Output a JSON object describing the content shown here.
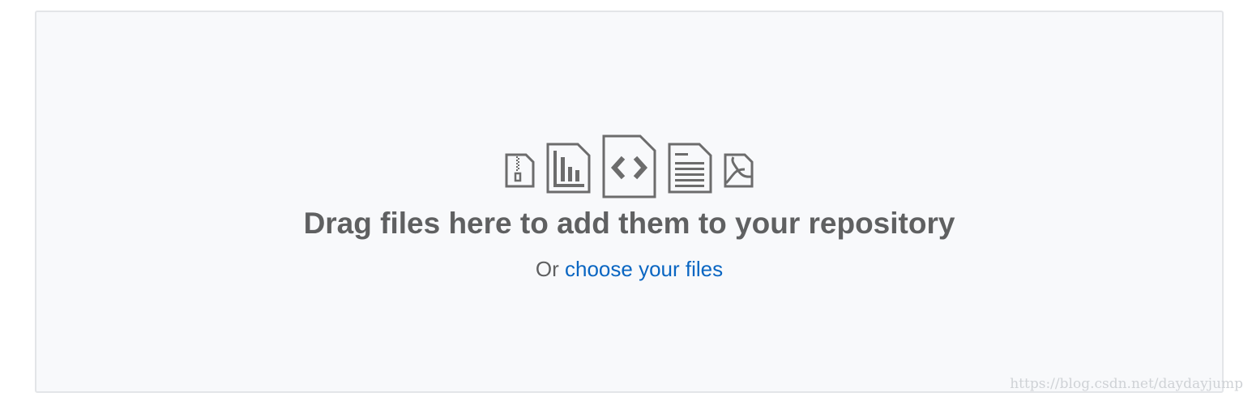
{
  "dropzone": {
    "headline": "Drag files here to add them to your repository",
    "prefix": "Or",
    "choose_link": "choose your files"
  },
  "icons": [
    "file-zip-icon",
    "file-chart-icon",
    "file-code-icon",
    "file-text-icon",
    "file-pdf-icon"
  ],
  "watermark": "https://blog.csdn.net/daydayjump",
  "colors": {
    "text": "#5f6061",
    "link": "#0a66c2",
    "icon": "#6c6c6c",
    "background": "#f8f9fb",
    "border": "#e3e5e8"
  }
}
